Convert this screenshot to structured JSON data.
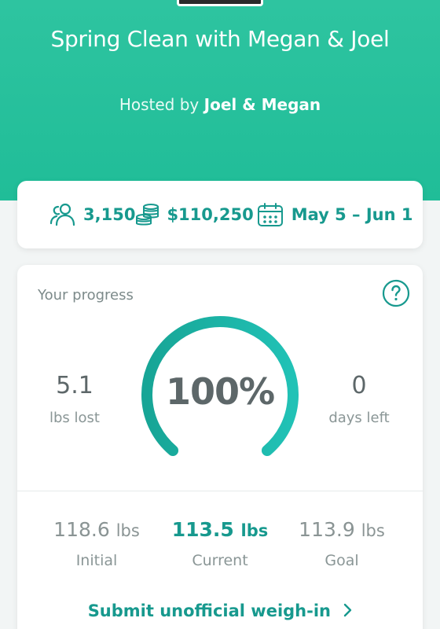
{
  "challenge": {
    "title": "Spring Clean with Megan & Joel",
    "hosted_prefix": "Hosted by",
    "hosts": "Joel & Megan"
  },
  "stats": {
    "participants": "3,150",
    "pot": "$110,250",
    "dates": "May 5 – Jun 1",
    "participants_icon": "people-icon",
    "pot_icon": "coins-icon",
    "dates_icon": "calendar-icon"
  },
  "progress": {
    "label": "Your progress",
    "percent_text": "100%",
    "percent": 100,
    "lost_value": "5.1",
    "lost_caption": "lbs lost",
    "days_value": "0",
    "days_caption": "days left",
    "help_icon": "question-icon"
  },
  "weights": {
    "unit": "lbs",
    "initial_value": "118.6",
    "initial_caption": "Initial",
    "current_value": "113.5",
    "current_caption": "Current",
    "goal_value": "113.9",
    "goal_caption": "Goal"
  },
  "actions": {
    "submit_label": "Submit unofficial weigh-in"
  },
  "colors": {
    "hero_green": "#21bf99",
    "accent_teal": "#17998e",
    "text_gray": "#5d6769"
  }
}
